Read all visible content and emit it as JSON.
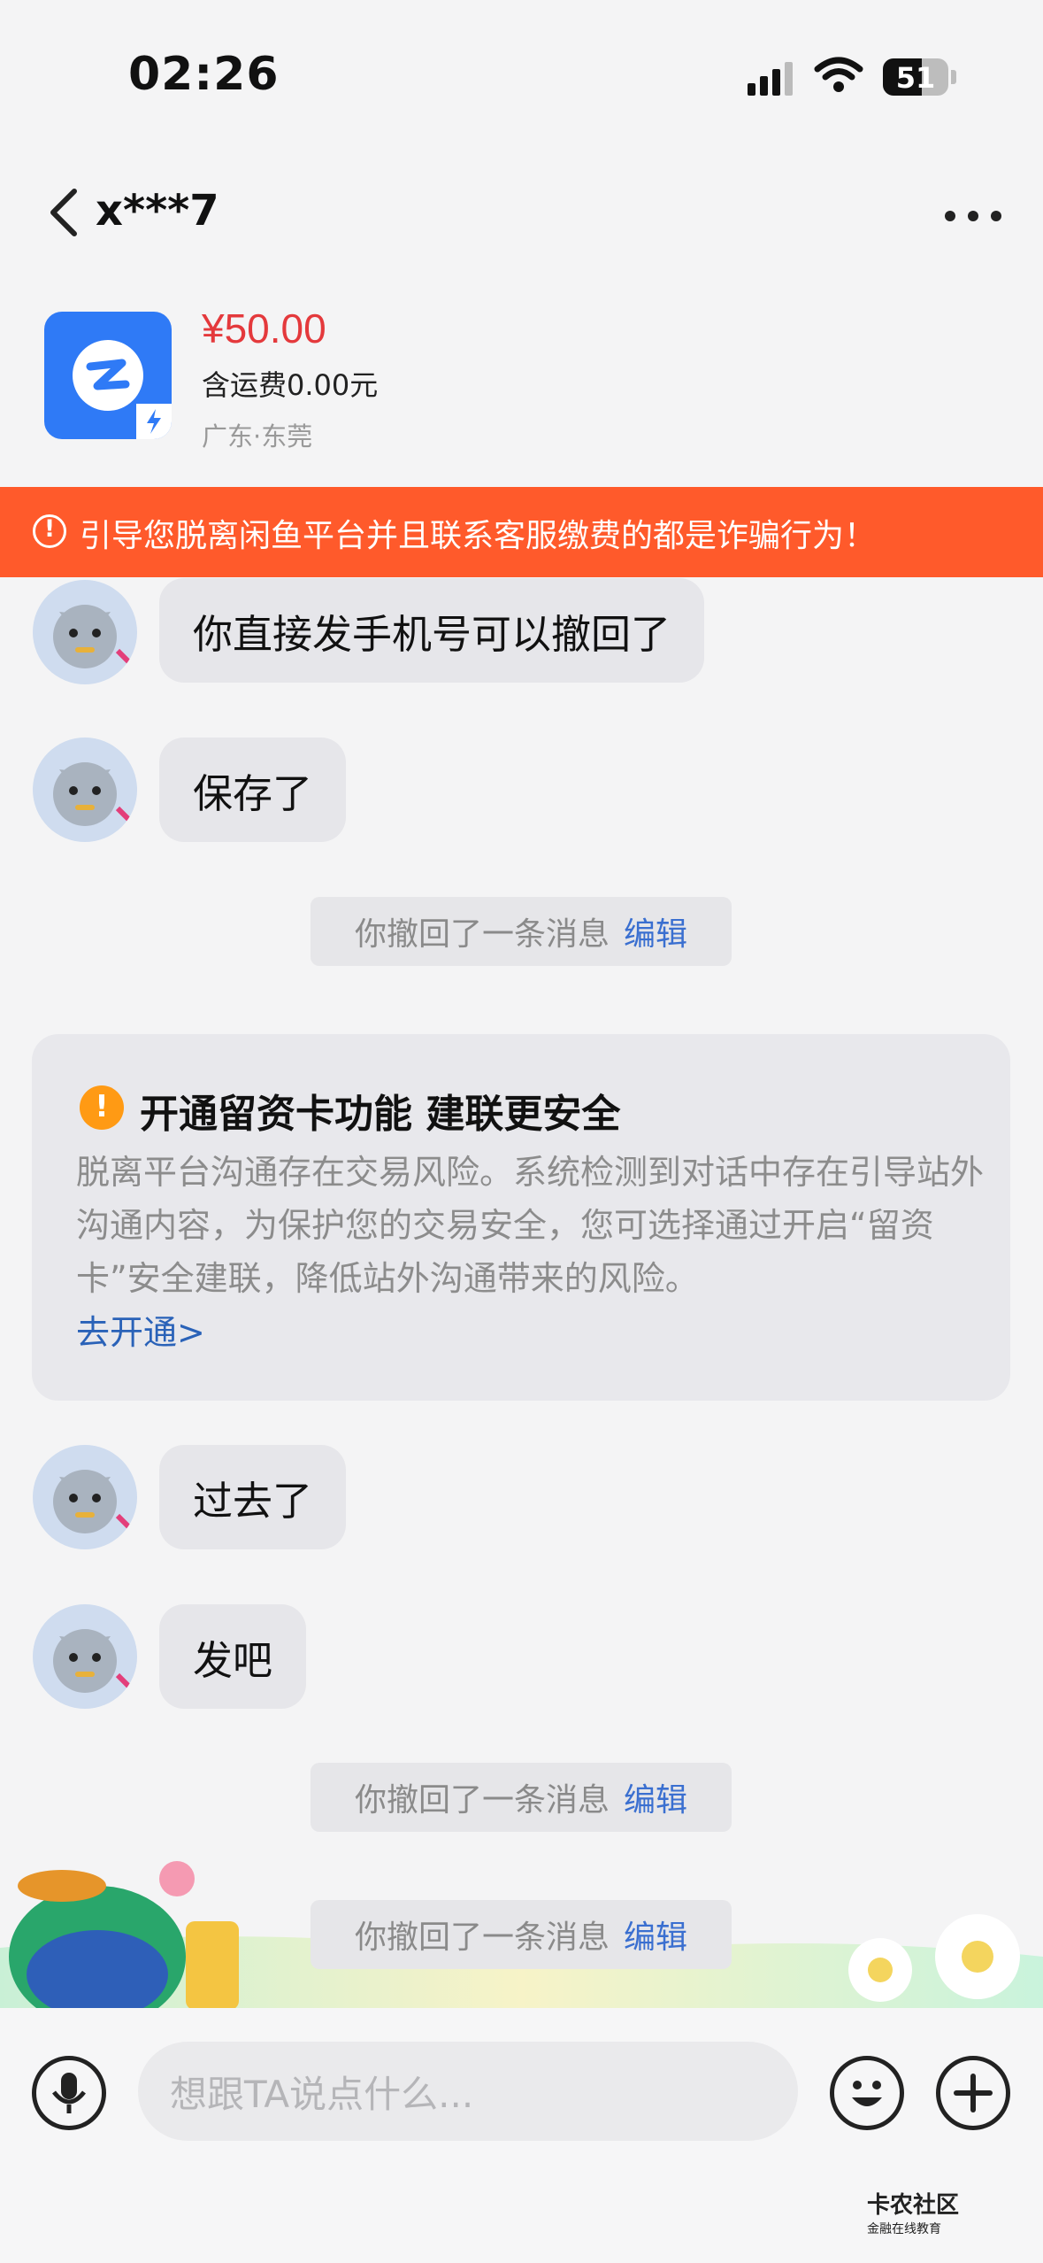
{
  "status_bar": {
    "time": "02:26",
    "battery": "51"
  },
  "nav": {
    "title": "x***7"
  },
  "product": {
    "price": "¥50.00",
    "shipping": "含运费0.00元",
    "location": "广东·东莞"
  },
  "warning": {
    "text": "引导您脱离闲鱼平台并且联系客服缴费的都是诈骗行为！"
  },
  "messages": [
    {
      "text": "你直接发手机号可以撤回了"
    },
    {
      "text": "保存了"
    },
    {
      "text": "过去了"
    },
    {
      "text": "发吧"
    }
  ],
  "system_messages": [
    {
      "text": "你撤回了一条消息",
      "action": "编辑"
    },
    {
      "text": "你撤回了一条消息",
      "action": "编辑"
    },
    {
      "text": "你撤回了一条消息",
      "action": "编辑"
    }
  ],
  "card": {
    "title": "开通留资卡功能  建联更安全",
    "body": "脱离平台沟通存在交易风险。系统检测到对话中存在引导站外沟通内容，为保护您的交易安全，您可选择通过开启“留资卡”安全建联，降低站外沟通带来的风险。",
    "link": "去开通>"
  },
  "input": {
    "placeholder": "想跟TA说点什么..."
  },
  "watermark": {
    "name": "卡农社区",
    "tagline": "金融在线教育"
  },
  "colors": {
    "accent": "#ff5a2b",
    "price": "#e4393c",
    "link": "#2a62b8"
  }
}
